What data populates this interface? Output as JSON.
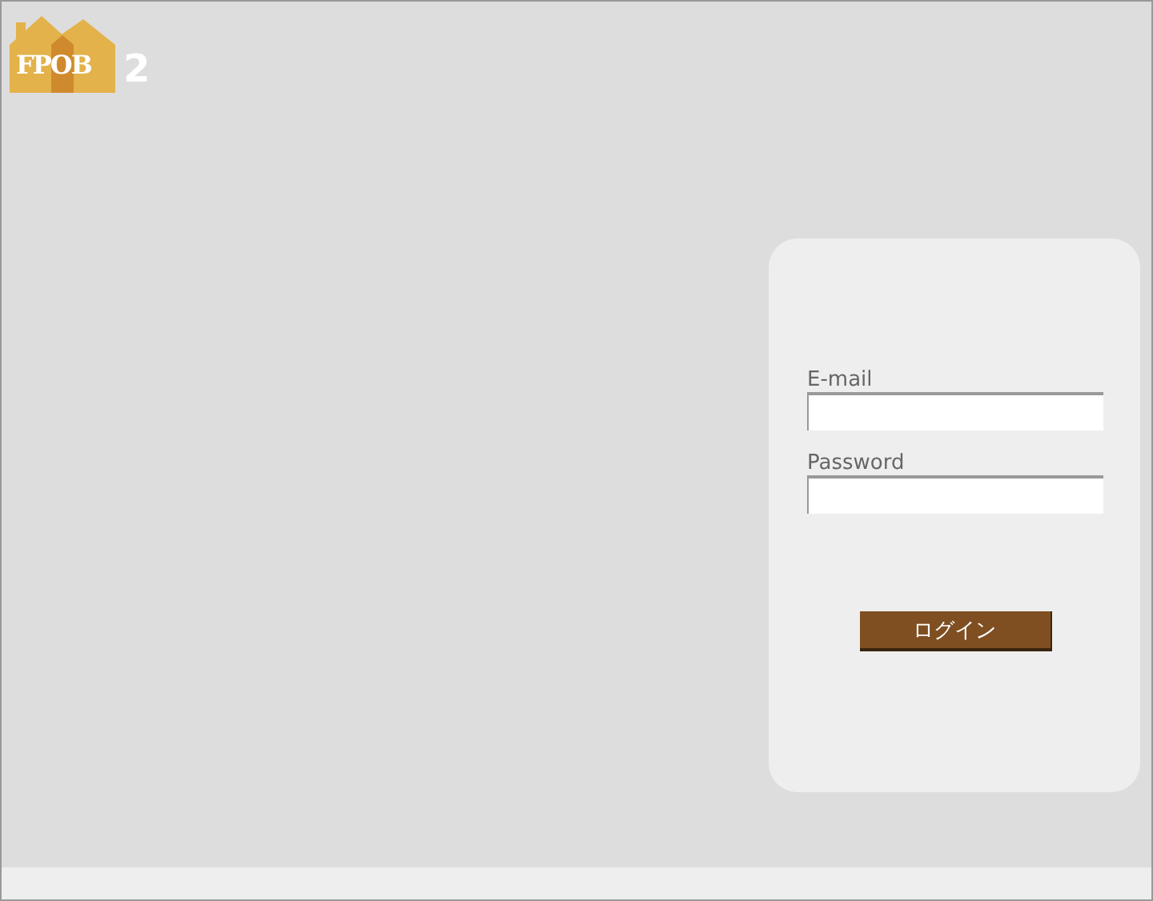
{
  "logo": {
    "name": "FPOB",
    "version": "2"
  },
  "login": {
    "fields": [
      {
        "label": "E-mail"
      },
      {
        "label": "Password"
      }
    ],
    "button": "ログイン"
  }
}
